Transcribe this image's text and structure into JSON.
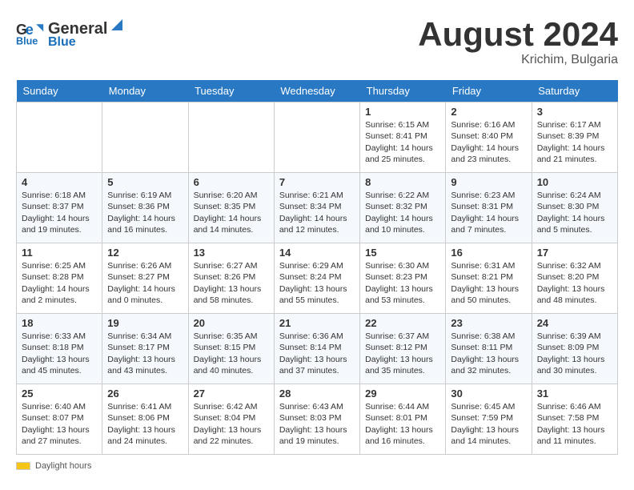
{
  "header": {
    "logo_line1": "General",
    "logo_line2": "Blue",
    "month_year": "August 2024",
    "location": "Krichim, Bulgaria"
  },
  "days_of_week": [
    "Sunday",
    "Monday",
    "Tuesday",
    "Wednesday",
    "Thursday",
    "Friday",
    "Saturday"
  ],
  "footer": {
    "daylight_label": "Daylight hours"
  },
  "weeks": [
    [
      {
        "day": "",
        "info": ""
      },
      {
        "day": "",
        "info": ""
      },
      {
        "day": "",
        "info": ""
      },
      {
        "day": "",
        "info": ""
      },
      {
        "day": "1",
        "info": "Sunrise: 6:15 AM\nSunset: 8:41 PM\nDaylight: 14 hours\nand 25 minutes."
      },
      {
        "day": "2",
        "info": "Sunrise: 6:16 AM\nSunset: 8:40 PM\nDaylight: 14 hours\nand 23 minutes."
      },
      {
        "day": "3",
        "info": "Sunrise: 6:17 AM\nSunset: 8:39 PM\nDaylight: 14 hours\nand 21 minutes."
      }
    ],
    [
      {
        "day": "4",
        "info": "Sunrise: 6:18 AM\nSunset: 8:37 PM\nDaylight: 14 hours\nand 19 minutes."
      },
      {
        "day": "5",
        "info": "Sunrise: 6:19 AM\nSunset: 8:36 PM\nDaylight: 14 hours\nand 16 minutes."
      },
      {
        "day": "6",
        "info": "Sunrise: 6:20 AM\nSunset: 8:35 PM\nDaylight: 14 hours\nand 14 minutes."
      },
      {
        "day": "7",
        "info": "Sunrise: 6:21 AM\nSunset: 8:34 PM\nDaylight: 14 hours\nand 12 minutes."
      },
      {
        "day": "8",
        "info": "Sunrise: 6:22 AM\nSunset: 8:32 PM\nDaylight: 14 hours\nand 10 minutes."
      },
      {
        "day": "9",
        "info": "Sunrise: 6:23 AM\nSunset: 8:31 PM\nDaylight: 14 hours\nand 7 minutes."
      },
      {
        "day": "10",
        "info": "Sunrise: 6:24 AM\nSunset: 8:30 PM\nDaylight: 14 hours\nand 5 minutes."
      }
    ],
    [
      {
        "day": "11",
        "info": "Sunrise: 6:25 AM\nSunset: 8:28 PM\nDaylight: 14 hours\nand 2 minutes."
      },
      {
        "day": "12",
        "info": "Sunrise: 6:26 AM\nSunset: 8:27 PM\nDaylight: 14 hours\nand 0 minutes."
      },
      {
        "day": "13",
        "info": "Sunrise: 6:27 AM\nSunset: 8:26 PM\nDaylight: 13 hours\nand 58 minutes."
      },
      {
        "day": "14",
        "info": "Sunrise: 6:29 AM\nSunset: 8:24 PM\nDaylight: 13 hours\nand 55 minutes."
      },
      {
        "day": "15",
        "info": "Sunrise: 6:30 AM\nSunset: 8:23 PM\nDaylight: 13 hours\nand 53 minutes."
      },
      {
        "day": "16",
        "info": "Sunrise: 6:31 AM\nSunset: 8:21 PM\nDaylight: 13 hours\nand 50 minutes."
      },
      {
        "day": "17",
        "info": "Sunrise: 6:32 AM\nSunset: 8:20 PM\nDaylight: 13 hours\nand 48 minutes."
      }
    ],
    [
      {
        "day": "18",
        "info": "Sunrise: 6:33 AM\nSunset: 8:18 PM\nDaylight: 13 hours\nand 45 minutes."
      },
      {
        "day": "19",
        "info": "Sunrise: 6:34 AM\nSunset: 8:17 PM\nDaylight: 13 hours\nand 43 minutes."
      },
      {
        "day": "20",
        "info": "Sunrise: 6:35 AM\nSunset: 8:15 PM\nDaylight: 13 hours\nand 40 minutes."
      },
      {
        "day": "21",
        "info": "Sunrise: 6:36 AM\nSunset: 8:14 PM\nDaylight: 13 hours\nand 37 minutes."
      },
      {
        "day": "22",
        "info": "Sunrise: 6:37 AM\nSunset: 8:12 PM\nDaylight: 13 hours\nand 35 minutes."
      },
      {
        "day": "23",
        "info": "Sunrise: 6:38 AM\nSunset: 8:11 PM\nDaylight: 13 hours\nand 32 minutes."
      },
      {
        "day": "24",
        "info": "Sunrise: 6:39 AM\nSunset: 8:09 PM\nDaylight: 13 hours\nand 30 minutes."
      }
    ],
    [
      {
        "day": "25",
        "info": "Sunrise: 6:40 AM\nSunset: 8:07 PM\nDaylight: 13 hours\nand 27 minutes."
      },
      {
        "day": "26",
        "info": "Sunrise: 6:41 AM\nSunset: 8:06 PM\nDaylight: 13 hours\nand 24 minutes."
      },
      {
        "day": "27",
        "info": "Sunrise: 6:42 AM\nSunset: 8:04 PM\nDaylight: 13 hours\nand 22 minutes."
      },
      {
        "day": "28",
        "info": "Sunrise: 6:43 AM\nSunset: 8:03 PM\nDaylight: 13 hours\nand 19 minutes."
      },
      {
        "day": "29",
        "info": "Sunrise: 6:44 AM\nSunset: 8:01 PM\nDaylight: 13 hours\nand 16 minutes."
      },
      {
        "day": "30",
        "info": "Sunrise: 6:45 AM\nSunset: 7:59 PM\nDaylight: 13 hours\nand 14 minutes."
      },
      {
        "day": "31",
        "info": "Sunrise: 6:46 AM\nSunset: 7:58 PM\nDaylight: 13 hours\nand 11 minutes."
      }
    ]
  ]
}
